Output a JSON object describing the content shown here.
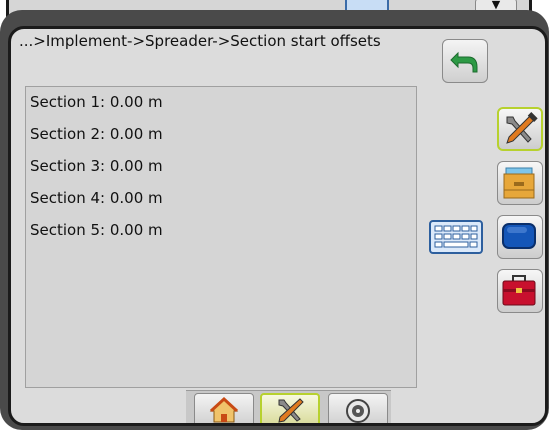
{
  "header": {
    "breadcrumb": "...>Implement->Spreader->Section start offsets"
  },
  "sections": [
    {
      "label": "Section 1: 0.00 m"
    },
    {
      "label": "Section 2: 0.00 m"
    },
    {
      "label": "Section 3: 0.00 m"
    },
    {
      "label": "Section 4: 0.00 m"
    },
    {
      "label": "Section 5: 0.00 m"
    }
  ],
  "icons": {
    "back": "back-arrow-icon",
    "keyboard": "keyboard-icon",
    "tools": "tools-icon",
    "files": "file-drawer-icon",
    "display": "display-icon",
    "toolbox": "toolbox-icon",
    "home": "home-icon",
    "gauge": "gauge-icon"
  },
  "colors": {
    "active_outline": "#b7d12e",
    "back_arrow": "#2d9a45",
    "toolbox_red": "#c8102e",
    "display_blue": "#1456b8"
  }
}
